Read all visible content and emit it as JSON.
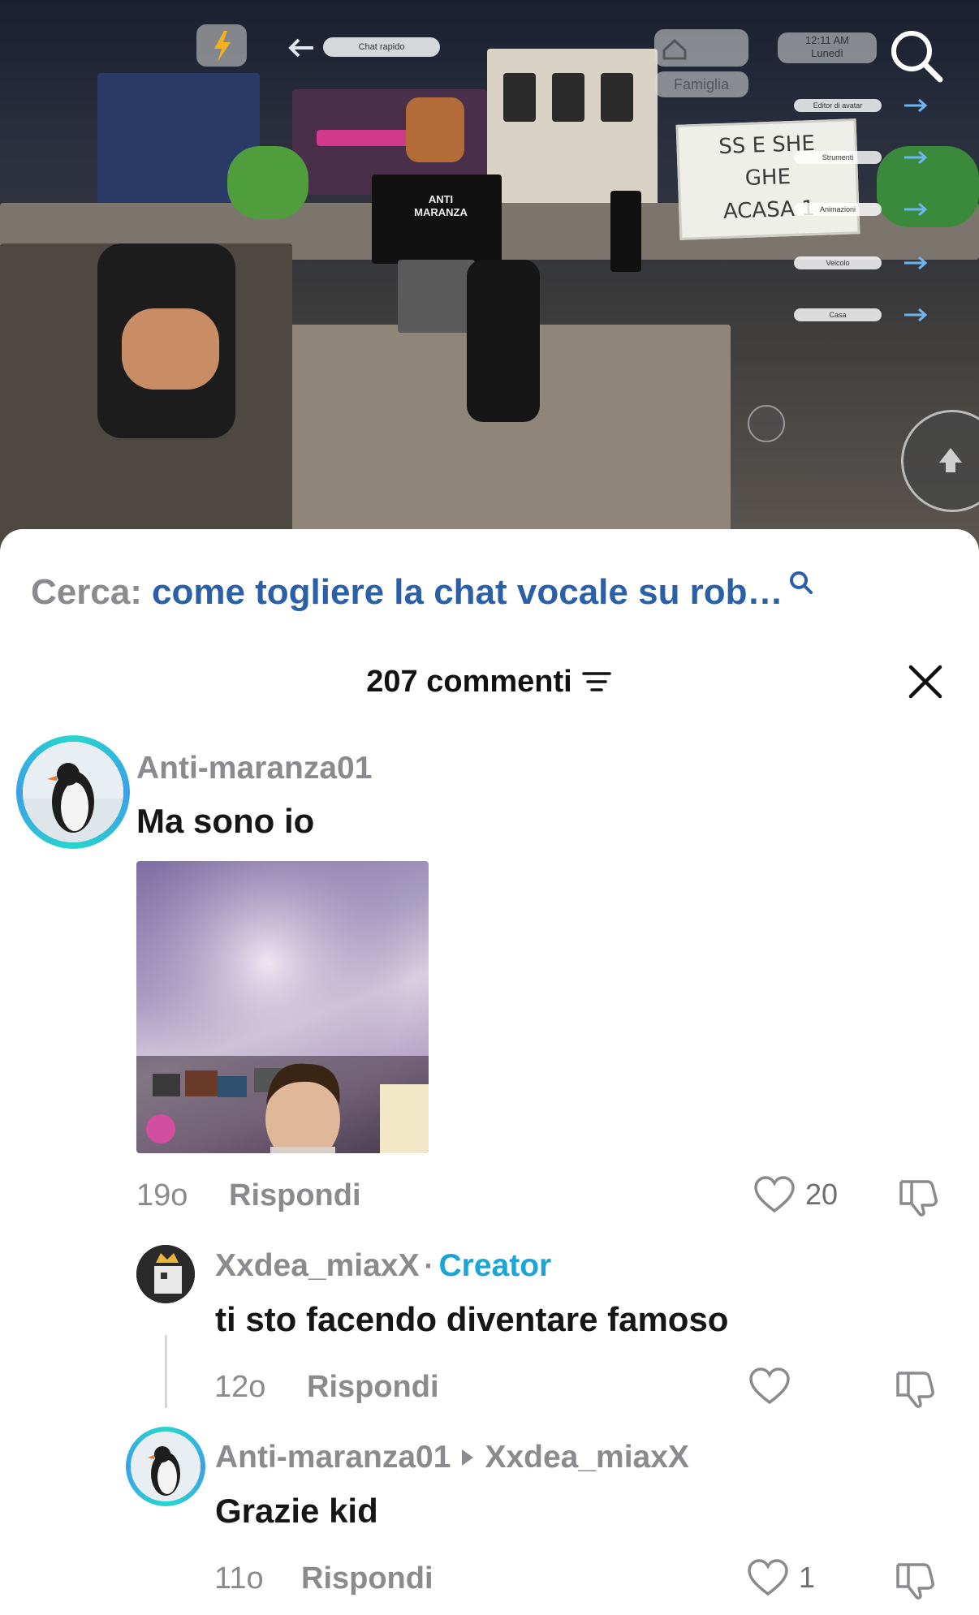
{
  "video": {
    "hud": {
      "quick_chat": "Chat rapido",
      "family": "Famiglia",
      "clock_time": "12:11 AM",
      "clock_day": "Lunedì",
      "menu_items": [
        "Editor di avatar",
        "Strumenti",
        "Animazioni",
        "Veicolo",
        "Casa"
      ]
    },
    "sign_lines": [
      "SS E SHE",
      "GHE",
      "ACASA 1"
    ],
    "shirt_text": [
      "ANTI",
      "MARANZA"
    ]
  },
  "search": {
    "prefix": "Cerca:",
    "query": "come togliere la chat vocale su rob…"
  },
  "header": {
    "comment_count": "207 commenti"
  },
  "comments": [
    {
      "username": "Anti-maranza01",
      "text": "Ma sono io",
      "age": "19o",
      "reply_label": "Rispondi",
      "likes": "20"
    },
    {
      "username": "Xxdea_miaxX",
      "badge": "Creator",
      "text": "ti sto facendo diventare famoso",
      "age": "12o",
      "reply_label": "Rispondi",
      "likes": ""
    },
    {
      "username": "Anti-maranza01",
      "reply_to": "Xxdea_miaxX",
      "text": "Grazie kid",
      "age": "11o",
      "reply_label": "Rispondi",
      "likes": "1"
    }
  ],
  "colors": {
    "accent_blue": "#2b5fa8",
    "creator": "#1aa5d8",
    "muted": "#8a8a8f"
  }
}
